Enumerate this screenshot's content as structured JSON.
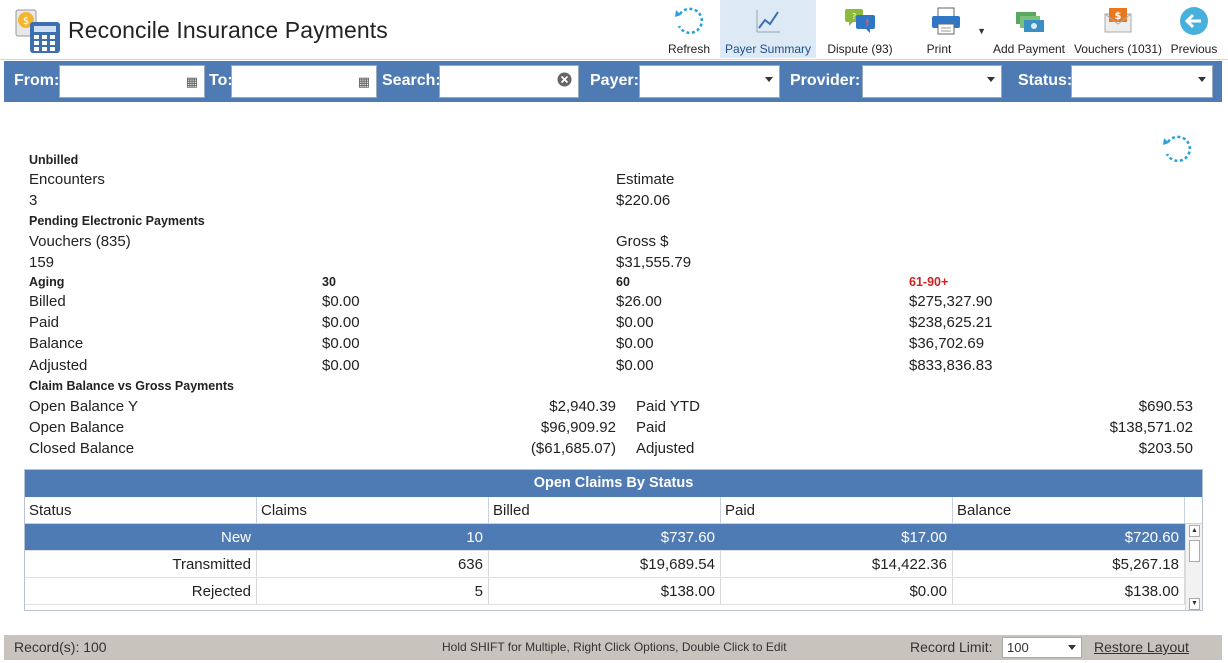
{
  "app": {
    "title": "Reconcile Insurance Payments",
    "icon": "calculator-icon"
  },
  "toolbar": {
    "refresh": "Refresh",
    "payer_summary": "Payer Summary",
    "dispute": "Dispute (93)",
    "print": "Print",
    "add_payment": "Add Payment",
    "vouchers": "Vouchers (1031)",
    "previous": "Previous"
  },
  "filters": {
    "from": "From:",
    "to": "To:",
    "search": "Search:",
    "payer": "Payer:",
    "provider": "Provider:",
    "status": "Status:"
  },
  "summary": {
    "unbilled": {
      "heading": "Unbilled",
      "label1": "Encounters",
      "value1": "3",
      "label2": "Estimate",
      "value2": "$220.06"
    },
    "pending": {
      "heading": "Pending Electronic Payments",
      "label1": "Vouchers (835)",
      "value1": "159",
      "label2": "Gross $",
      "value2": "$31,555.79"
    },
    "aging": {
      "heading": "Aging",
      "col30": "30",
      "col60": "60",
      "col90": "61-90+",
      "rows": [
        {
          "label": "Billed",
          "v30": "$0.00",
          "v60": "$26.00",
          "v90": "$275,327.90"
        },
        {
          "label": "Paid",
          "v30": "$0.00",
          "v60": "$0.00",
          "v90": "$238,625.21"
        },
        {
          "label": "Balance",
          "v30": "$0.00",
          "v60": "$0.00",
          "v90": "$36,702.69"
        },
        {
          "label": "Adjusted",
          "v30": "$0.00",
          "v60": "$0.00",
          "v90": "$833,836.83"
        }
      ]
    },
    "claim_balance": {
      "heading": "Claim Balance vs Gross Payments",
      "rows": [
        {
          "label": "Open Balance Y",
          "value": "$2,940.39",
          "label2": "Paid YTD",
          "value2": "$690.53"
        },
        {
          "label": "Open Balance",
          "value": "$96,909.92",
          "label2": "Paid",
          "value2": "$138,571.02"
        },
        {
          "label": "Closed Balance",
          "value": "($61,685.07)",
          "label2": "Adjusted",
          "value2": "$203.50"
        }
      ]
    }
  },
  "table": {
    "title": "Open Claims By Status",
    "columns": [
      "Status",
      "Claims",
      "Billed",
      "Paid",
      "Balance"
    ],
    "rows": [
      {
        "status": "New",
        "claims": "10",
        "billed": "$737.60",
        "paid": "$17.00",
        "balance": "$720.60"
      },
      {
        "status": "Transmitted",
        "claims": "636",
        "billed": "$19,689.54",
        "paid": "$14,422.36",
        "balance": "$5,267.18"
      },
      {
        "status": "Rejected",
        "claims": "5",
        "billed": "$138.00",
        "paid": "$0.00",
        "balance": "$138.00"
      }
    ]
  },
  "footer": {
    "records": "Record(s): 100",
    "hint": "Hold SHIFT for Multiple, Right Click Options, Double Click to Edit",
    "record_limit_label": "Record Limit:",
    "record_limit_value": "100",
    "restore_layout": "Restore Layout"
  },
  "colors": {
    "accent": "#4f7bb5",
    "alert": "#cc2222"
  }
}
